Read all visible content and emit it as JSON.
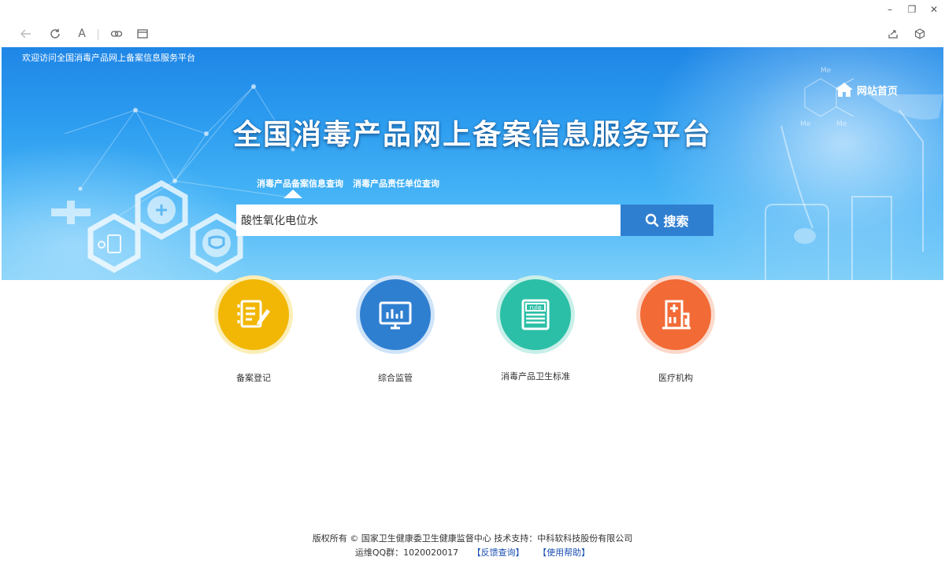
{
  "window": {
    "minimize_glyph": "–",
    "restore_glyph": "❐",
    "close_glyph": "✕"
  },
  "toolbar": {
    "icons": [
      "back-arrow-icon",
      "refresh-icon",
      "font-icon",
      "link-icon",
      "reader-mode-icon",
      "share-icon",
      "extension-cube-icon"
    ],
    "font_glyph": "A"
  },
  "banner": {
    "welcome_text": "欢迎访问全国消毒产品网上备案信息服务平台",
    "home_link": "网站首页",
    "title": "全国消毒产品网上备案信息服务平台",
    "colors": {
      "banner_top": "#1f86e6",
      "banner_bottom": "#7dcff9",
      "search_button": "#2f7fd1"
    }
  },
  "search": {
    "tabs": [
      {
        "label": "消毒产品备案信息查询",
        "active": true
      },
      {
        "label": "消毒产品责任单位查询",
        "active": false
      }
    ],
    "value": "酸性氧化电位水",
    "button_label": "搜索"
  },
  "categories": [
    {
      "label": "备案登记",
      "icon": "registration-edit-icon",
      "color": "#f2b705",
      "ring": "#fbeeb8"
    },
    {
      "label": "综合监管",
      "icon": "monitor-chart-icon",
      "color": "#2f7fd1",
      "ring": "#cfe4f8"
    },
    {
      "label": "消毒产品卫生标准",
      "icon": "rule-document-icon",
      "color": "#2bbfa7",
      "ring": "#c9efe9",
      "icon_text": "rule"
    },
    {
      "label": "医疗机构",
      "icon": "hospital-building-icon",
      "color": "#f26a36",
      "ring": "#fbd9cb"
    }
  ],
  "footer": {
    "line1": "版权所有 © 国家卫生健康委卫生健康监督中心  技术支持：中科软科技股份有限公司",
    "qq_group": "运维QQ群：1020020017",
    "feedback_link": "【反馈查询】",
    "help_link": "【使用帮助】"
  }
}
